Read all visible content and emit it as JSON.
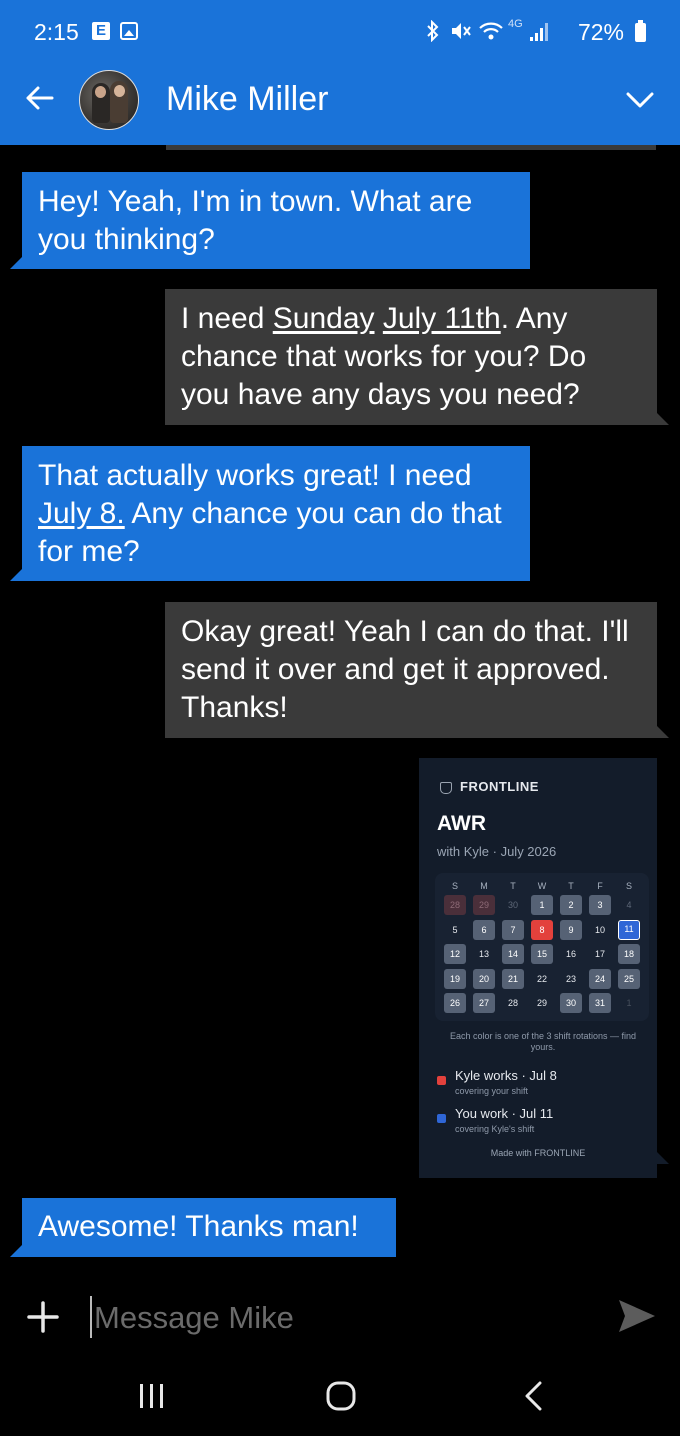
{
  "status_bar": {
    "time": "2:15",
    "left_icons": [
      "e-app-icon",
      "gallery-icon"
    ],
    "right_icons": [
      "bluetooth-icon",
      "mute-icon",
      "wifi-icon",
      "4g-icon",
      "signal-icon",
      "battery-icon"
    ],
    "network": "4G",
    "battery": "72%"
  },
  "header": {
    "contact_name": "Mike Miller",
    "back_icon": "arrow-left-icon",
    "expand_icon": "chevron-down-icon"
  },
  "messages": [
    {
      "side": "received",
      "parts": [
        "Hey! Yeah, I'm in town. What are you thinking?"
      ]
    },
    {
      "side": "sent",
      "parts": [
        "I need ",
        "Sunday",
        " ",
        "July 11th",
        ". Any chance that works for you? Do you have any days you need?"
      ]
    },
    {
      "side": "received",
      "parts": [
        "That actually works great! I need ",
        "July 8.",
        " Any chance you can do that for me?"
      ]
    },
    {
      "side": "sent",
      "parts": [
        "Okay great! Yeah I can do that. I'll send it over and get it approved. Thanks!"
      ]
    },
    {
      "side": "received",
      "parts": [
        "Awesome! Thanks man!"
      ]
    }
  ],
  "card": {
    "brand": "FRONTLINE",
    "title": "AWR",
    "subtitle": "with Kyle · July 2026",
    "weekdays": [
      "S",
      "M",
      "T",
      "W",
      "T",
      "F",
      "S"
    ],
    "weeks": [
      [
        {
          "d": "28",
          "s": "pink"
        },
        {
          "d": "29",
          "s": "pink"
        },
        {
          "d": "30",
          "s": "none"
        },
        {
          "d": "1",
          "s": "gray"
        },
        {
          "d": "2",
          "s": "gray"
        },
        {
          "d": "3",
          "s": "gray"
        },
        {
          "d": "4",
          "s": "none"
        }
      ],
      [
        {
          "d": "5",
          "s": "none"
        },
        {
          "d": "6",
          "s": "gray"
        },
        {
          "d": "7",
          "s": "gray"
        },
        {
          "d": "8",
          "s": "red"
        },
        {
          "d": "9",
          "s": "gray"
        },
        {
          "d": "10",
          "s": "none"
        },
        {
          "d": "11",
          "s": "blue"
        }
      ],
      [
        {
          "d": "12",
          "s": "gray"
        },
        {
          "d": "13",
          "s": "none"
        },
        {
          "d": "14",
          "s": "gray"
        },
        {
          "d": "15",
          "s": "gray"
        },
        {
          "d": "16",
          "s": "none"
        },
        {
          "d": "17",
          "s": "none"
        },
        {
          "d": "18",
          "s": "gray"
        }
      ],
      [
        {
          "d": "19",
          "s": "gray"
        },
        {
          "d": "20",
          "s": "gray"
        },
        {
          "d": "21",
          "s": "gray"
        },
        {
          "d": "22",
          "s": "none"
        },
        {
          "d": "23",
          "s": "none"
        },
        {
          "d": "24",
          "s": "gray"
        },
        {
          "d": "25",
          "s": "gray"
        }
      ],
      [
        {
          "d": "26",
          "s": "gray"
        },
        {
          "d": "27",
          "s": "gray"
        },
        {
          "d": "28",
          "s": "none"
        },
        {
          "d": "29",
          "s": "none"
        },
        {
          "d": "30",
          "s": "gray"
        },
        {
          "d": "31",
          "s": "gray"
        },
        {
          "d": "1",
          "s": "dim"
        }
      ]
    ],
    "note": "Each color is one of the 3 shift rotations — find yours.",
    "legend": [
      {
        "color": "#e3413c",
        "label": "Kyle works · Jul 8",
        "detail": "covering your shift"
      },
      {
        "color": "#2f66d6",
        "label": "You work · Jul 11",
        "detail": "covering Kyle's shift"
      }
    ],
    "footer": "Made with FRONTLINE"
  },
  "composer": {
    "placeholder": "Message Mike",
    "add_icon": "plus-icon",
    "send_icon": "send-icon"
  },
  "nav_bar": [
    "recent-apps-icon",
    "home-icon",
    "back-icon"
  ],
  "colors": {
    "header": "#1a73d9",
    "received_bubble": "#1a73d9",
    "sent_bubble": "#3a3a3a",
    "background": "#000000"
  }
}
